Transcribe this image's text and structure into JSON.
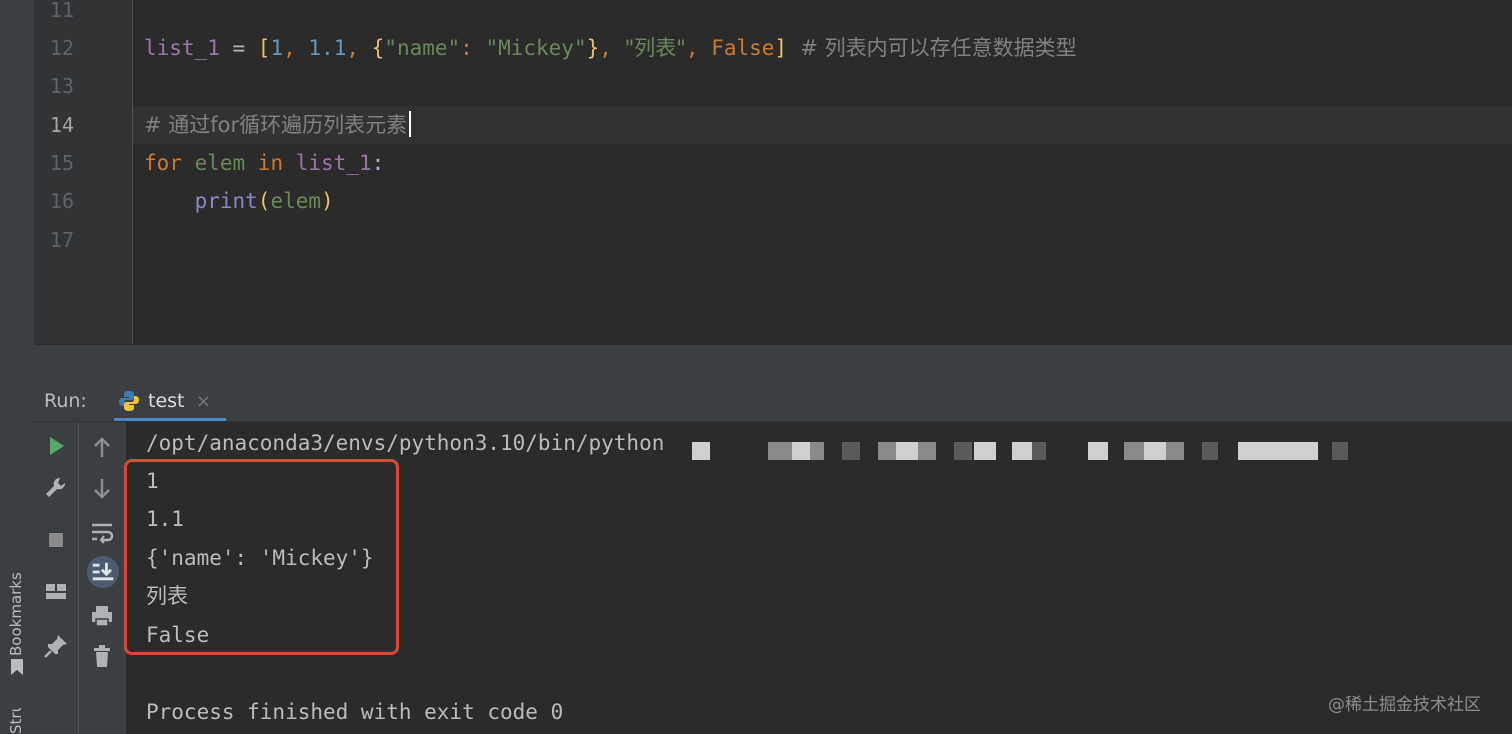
{
  "editor": {
    "line_numbers": [
      "11",
      "12",
      "13",
      "14",
      "15",
      "16",
      "17"
    ],
    "active_line": "14",
    "code": {
      "line12": {
        "var": "list_1",
        "eq": " = ",
        "open_bracket": "[",
        "n1": "1",
        "sep1": ", ",
        "n2": "1.1",
        "sep2": ", ",
        "open_brace": "{",
        "key": "\"name\"",
        "colon": ": ",
        "value": "\"Mickey\"",
        "close_brace": "}",
        "sep3": ", ",
        "s_list": "\"列表\"",
        "sep4": ", ",
        "false_kw": "False",
        "close_bracket": "]",
        "comment": "  # 列表内可以存任意数据类型"
      },
      "line14": {
        "comment": "# 通过for循环遍历列表元素"
      },
      "line15": {
        "for_kw": "for",
        "elem": " elem ",
        "in_kw": "in",
        "iter": " list_1",
        "colon": ":"
      },
      "line16": {
        "indent": "    ",
        "func": "print",
        "open": "(",
        "arg": "elem",
        "close": ")"
      }
    }
  },
  "run_panel": {
    "label": "Run:",
    "tab_name": "test",
    "tab_close": "×",
    "command": "/opt/anaconda3/envs/python3.10/bin/python",
    "output_lines": [
      "1",
      "1.1",
      "{'name': 'Mickey'}",
      "列表",
      "False"
    ],
    "exit_message": "Process finished with exit code 0"
  },
  "side_labels": {
    "bookmarks": "Bookmarks",
    "structure": "Structure"
  },
  "watermark": "@稀土掘金技术社区",
  "colors": {
    "highlight_box": "#e0453a",
    "run_green": "#59a869",
    "keyword": "#cc7832",
    "number": "#6897bb",
    "string": "#6a8759"
  },
  "icons": {
    "run": "run-icon",
    "wrench": "wrench-icon",
    "stop": "stop-icon",
    "layout": "layout-icon",
    "pin": "pin-icon",
    "up": "arrow-up-icon",
    "down": "arrow-down-icon",
    "soft_wrap": "soft-wrap-icon",
    "scroll_end": "scroll-to-end-icon",
    "print": "print-icon",
    "trash": "trash-icon"
  }
}
